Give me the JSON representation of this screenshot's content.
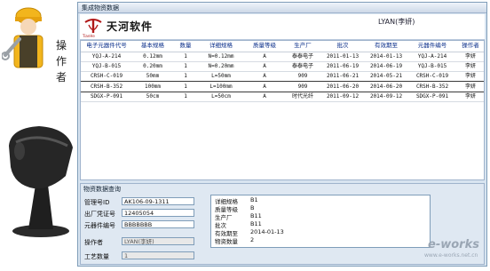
{
  "side": {
    "operator_chars": [
      "操",
      "作",
      "者"
    ]
  },
  "window": {
    "title": "集成物资数据",
    "brand": "天河软件",
    "logo_caption": "TianHe",
    "user": "LYAN(李妍)"
  },
  "grid": {
    "columns": [
      "电子元器件代号",
      "基本规格",
      "数量",
      "详细规格",
      "质量等级",
      "生产厂",
      "批次",
      "有效期至",
      "元器件编号",
      "操作者"
    ],
    "rows": [
      [
        "YQJ-A-214",
        "0.12mm",
        "1",
        "N=0.12mm",
        "A",
        "泰泰电子",
        "2011-01-13",
        "2014-01-13",
        "YQJ-A-214",
        "李妍"
      ],
      [
        "YQJ-B-015",
        "0.20mm",
        "1",
        "N=0.20mm",
        "A",
        "泰泰电子",
        "2011-06-19",
        "2014-06-19",
        "YQJ-B-015",
        "李妍"
      ],
      [
        "CRSH-C-019",
        "50mm",
        "1",
        "L=50mm",
        "A",
        "909",
        "2011-06-21",
        "2014-05-21",
        "CRSH-C-019",
        "李妍"
      ],
      [
        "CRSH-B-352",
        "100mm",
        "1",
        "L=100mm",
        "A",
        "909",
        "2011-06-20",
        "2014-06-20",
        "CRSH-B-352",
        "李妍"
      ],
      [
        "SDGX-P-091",
        "50cm",
        "1",
        "L=50cm",
        "A",
        "时代光纤",
        "2011-09-12",
        "2014-09-12",
        "SDGX-P-091",
        "李妍"
      ]
    ],
    "selected_row": 3
  },
  "detail": {
    "group_title": "物资数据查询",
    "left_fields": [
      {
        "label": "管理号ID",
        "value": "AK106-09-1311"
      },
      {
        "label": "出厂凭证号",
        "value": "12405054"
      },
      {
        "label": "元器件编号",
        "value": "BBBBBBB"
      }
    ],
    "operator": {
      "label": "操作者",
      "value": "LYAN(李妍)"
    },
    "craft": {
      "label": "工艺数量",
      "value": "1"
    },
    "right_fields": [
      {
        "label": "详细规格",
        "value": "B1"
      },
      {
        "label": "质量等级",
        "value": "B"
      },
      {
        "label": "生产厂",
        "value": "B11"
      },
      {
        "label": "批次",
        "value": "B11"
      },
      {
        "label": "有效期至",
        "value": "2014-01-13"
      },
      {
        "label": "物资数量",
        "value": "2"
      }
    ]
  },
  "watermark": {
    "main": "e-works",
    "sub": "www.e-works.net.cn"
  }
}
